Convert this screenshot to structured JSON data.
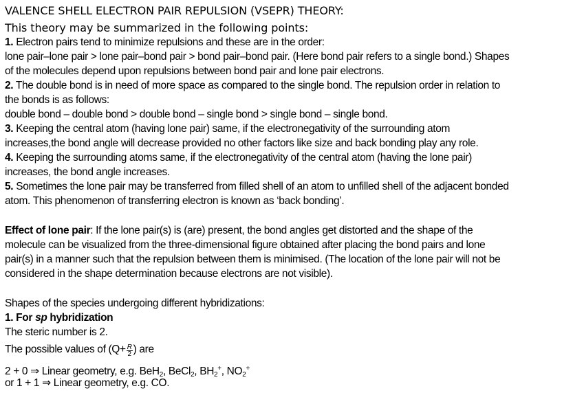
{
  "title": "VALENCE SHELL ELECTRON PAIR REPULSION (VSEPR) THEORY:",
  "intro": "This theory may be summarized in the following points:",
  "points": {
    "p1": {
      "num": "1.",
      "line1": "Electron pairs tend to minimize repulsions and these are in the order:",
      "line2": "lone pair–lone pair > lone pair–bond pair > bond pair–bond pair. (Here bond pair refers to a single bond.) Shapes",
      "line3": "of the molecules depend upon repulsions between bond pair and lone pair electrons."
    },
    "p2": {
      "num": "2.",
      "line1": "The double bond is in need of more space as compared to the single bond. The repulsion order in relation to",
      "line2": "the bonds is as follows:",
      "line3": "double bond – double bond > double bond – single bond > single bond – single bond."
    },
    "p3": {
      "num": "3.",
      "line1": "Keeping the central atom (having lone pair) same, if the electronegativity of the surrounding atom",
      "line2": "increases,the bond angle will decrease provided no other factors like size and back bonding play any role."
    },
    "p4": {
      "num": "4.",
      "line1": "Keeping the surrounding atoms same, if the electronegativity of the central atom (having the lone pair)",
      "line2": "increases, the bond angle increases."
    },
    "p5": {
      "num": "5.",
      "line1": "Sometimes the lone pair may be transferred from filled shell of an atom to unfilled shell of the adjacent bonded",
      "line2": "atom. This phenomenon of transferring electron is known as ‘back bonding’."
    }
  },
  "lone_pair": {
    "label": "Effect of lone pair",
    "line1": ": If the lone pair(s) is (are) present, the bond angles get distorted and the shape of the",
    "line2": "molecule can be visualized from the three-dimensional figure obtained after placing the bond pairs and lone",
    "line3": "pair(s) in a manner such that the repulsion between them is minimised. (The location of the lone pair will not be",
    "line4": "considered in the shape determination because electrons are not visible)."
  },
  "shapes": {
    "intro": "Shapes of the species undergoing different hybridizations:",
    "heading_num": "1. For ",
    "heading_sp": "sp",
    "heading_rest": " hybridization",
    "steric": "The steric number is 2.",
    "possible_pre": "The possible values of (Q+",
    "frac_num": "R",
    "frac_den": "2",
    "possible_post": ") are",
    "ex1": {
      "lead": "2 + 0 ⇒ Linear geometry, e.g. BeH",
      "s1": "2",
      "m1": ", BeCl",
      "s2": "2",
      "m2": ", BH",
      "s3": "2",
      "p3": "+",
      "m3": ",  NO",
      "s4": "2",
      "p4": "+"
    },
    "ex2": "or 1 + 1 ⇒ Linear geometry, e.g. CO."
  }
}
